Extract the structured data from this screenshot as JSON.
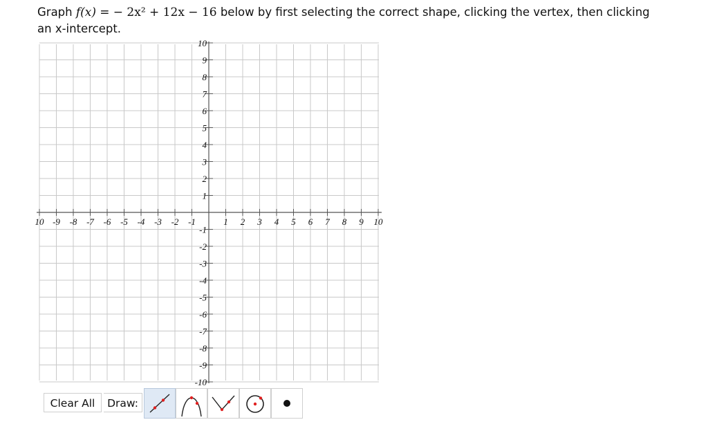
{
  "question": {
    "prefix": "Graph ",
    "function_lhs": "f(x)",
    "equals": "=",
    "expression": "− 2x² + 12x − 16",
    "suffix": " below by first selecting the correct shape, clicking the vertex, then clicking an x-intercept."
  },
  "graph": {
    "x_range": [
      -10,
      10
    ],
    "y_range": [
      -10,
      10
    ],
    "x_tick_labels": [
      "10",
      "-9",
      "-8",
      "-7",
      "-6",
      "-5",
      "-4",
      "-3",
      "-2",
      "-1",
      "1",
      "2",
      "3",
      "4",
      "5",
      "6",
      "7",
      "8",
      "9",
      "10"
    ],
    "y_tick_labels": [
      "10",
      "9",
      "8",
      "7",
      "6",
      "5",
      "4",
      "3",
      "2",
      "1",
      "-1",
      "-2",
      "-3",
      "-4",
      "-5",
      "-6",
      "-7",
      "-8",
      "-9",
      "-10"
    ],
    "colors": {
      "grid": "#c8c8c8",
      "axis": "#555555"
    }
  },
  "toolbar": {
    "clear_label": "Clear All",
    "draw_label": "Draw:",
    "tools": [
      {
        "name": "line-tool-icon",
        "selected": true
      },
      {
        "name": "parabola-down-tool-icon",
        "selected": false
      },
      {
        "name": "absolute-value-tool-icon",
        "selected": false
      },
      {
        "name": "circle-tool-icon",
        "selected": false
      },
      {
        "name": "point-tool-icon",
        "selected": false
      }
    ],
    "colors": {
      "selected_bg": "#dfe9f5",
      "point": "#e02020"
    }
  }
}
